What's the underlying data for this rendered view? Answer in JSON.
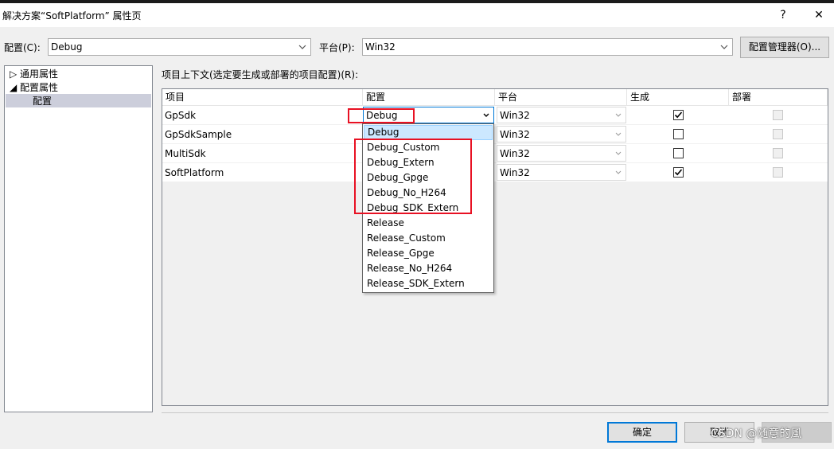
{
  "window": {
    "title": "解决方案“SoftPlatform” 属性页",
    "help": "?",
    "close": "✕"
  },
  "toolbar": {
    "config_label": "配置(C):",
    "config_value": "Debug",
    "platform_label": "平台(P):",
    "platform_value": "Win32",
    "config_manager": "配置管理器(O)..."
  },
  "tree": {
    "items": [
      {
        "label": "▷ 通用属性"
      },
      {
        "label": "◢ 配置属性"
      },
      {
        "label": "配置"
      }
    ]
  },
  "context": {
    "label": "项目上下文(选定要生成或部署的项目配置)(R):",
    "headers": [
      "项目",
      "配置",
      "平台",
      "生成",
      "部署"
    ],
    "rows": [
      {
        "project": "GpSdk",
        "config": "Debug",
        "platform": "Win32",
        "build": true
      },
      {
        "project": "GpSdkSample",
        "config": "",
        "platform": "Win32",
        "build": false
      },
      {
        "project": "MultiSdk",
        "config": "",
        "platform": "Win32",
        "build": false
      },
      {
        "project": "SoftPlatform",
        "config": "",
        "platform": "Win32",
        "build": true
      }
    ]
  },
  "dropdown": {
    "options": [
      "Debug",
      "Debug_Custom",
      "Debug_Extern",
      "Debug_Gpge",
      "Debug_No_H264",
      "Debug_SDK_Extern",
      "Release",
      "Release_Custom",
      "Release_Gpge",
      "Release_No_H264",
      "Release_SDK_Extern"
    ],
    "selected": "Debug"
  },
  "footer": {
    "ok": "确定",
    "cancel": "取消",
    "watermark": "CSDN @随意的風"
  },
  "colors": {
    "highlight": "#e81123",
    "selection": "#cce8ff",
    "primary_border": "#0078d7"
  }
}
